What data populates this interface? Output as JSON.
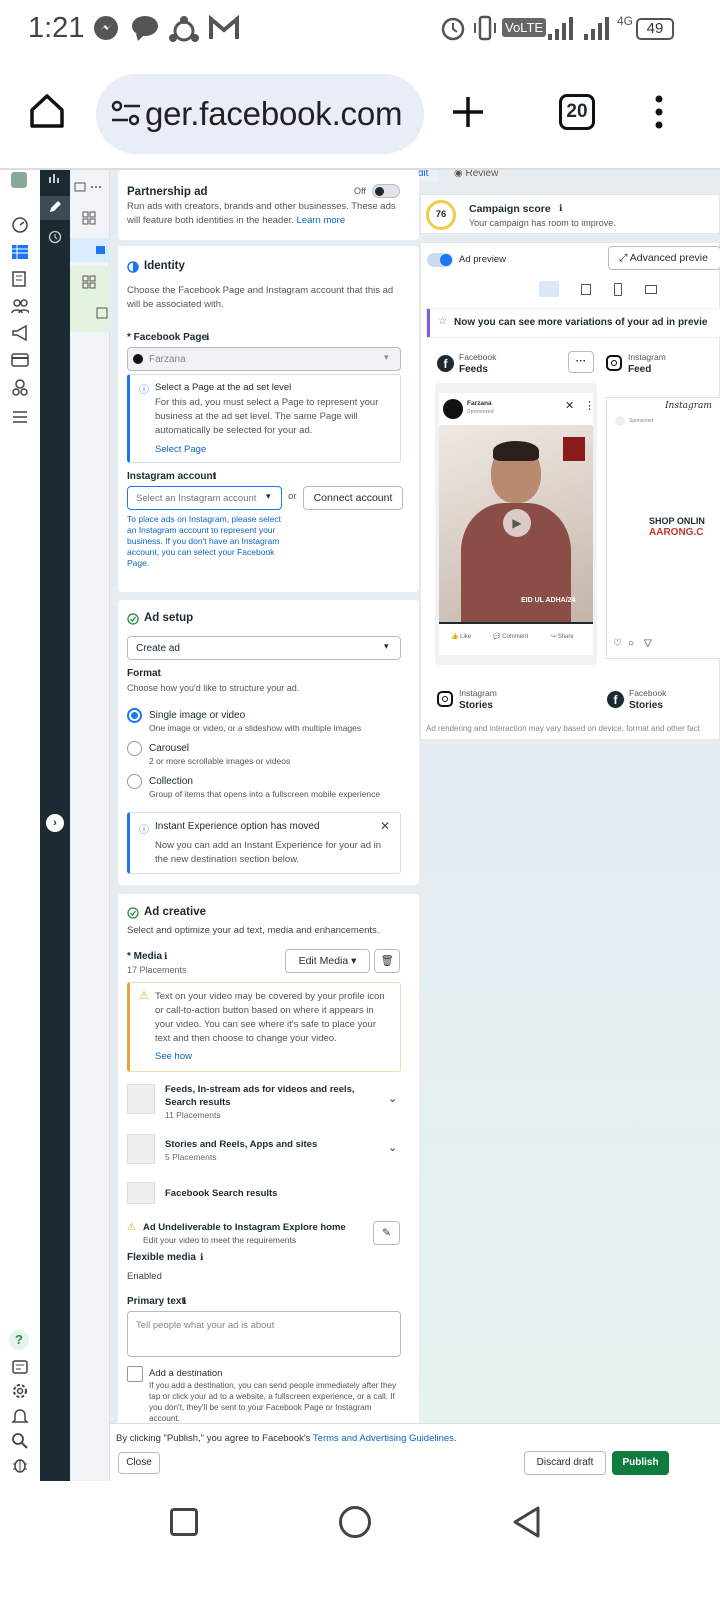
{
  "status_bar": {
    "time": "1:21",
    "volte": "VoLTE",
    "network": "4G",
    "battery": "49"
  },
  "browser": {
    "url": "ger.facebook.com",
    "tab_count": "20"
  },
  "header_tabs": {
    "edit": "Edit",
    "review": "Review"
  },
  "partnership": {
    "title": "Partnership ad",
    "toggle_label": "Off",
    "desc1": "Run ads with creators, brands and other businesses. These ads",
    "desc2": "will feature both identities in the header.",
    "learn_more": "Learn more"
  },
  "identity": {
    "title": "Identity",
    "desc1": "Choose the Facebook Page and Instagram account that this ad",
    "desc2": "will be associated with.",
    "fb_page_label": "* Facebook Page",
    "fb_page_value": "Farzana",
    "info_title": "Select a Page at the ad set level",
    "info_l1": "For this ad, you must select a Page to represent your",
    "info_l2": "business at the ad set level. The same Page will",
    "info_l3": "automatically be selected for your ad.",
    "select_page": "Select Page",
    "ig_label": "Instagram account",
    "ig_placeholder": "Select an Instagram account",
    "or": "or",
    "connect": "Connect account",
    "ig_help1": "To place ads on Instagram, please select",
    "ig_help2": "an Instagram account to represent your",
    "ig_help3": "business. If you don't have an Instagram",
    "ig_help4": "account, you can select your Facebook",
    "ig_help5": "Page."
  },
  "ad_setup": {
    "title": "Ad setup",
    "create_value": "Create ad",
    "format_label": "Format",
    "format_desc": "Choose how you'd like to structure your ad.",
    "options": [
      {
        "label": "Single image or video",
        "desc": "One image or video, or a slideshow with multiple images"
      },
      {
        "label": "Carousel",
        "desc": "2 or more scrollable images or videos"
      },
      {
        "label": "Collection",
        "desc": "Group of items that opens into a fullscreen mobile experience"
      }
    ],
    "notice_title": "Instant Experience option has moved",
    "notice_l1": "Now you can add an Instant Experience for your ad in",
    "notice_l2": "the new destination section below."
  },
  "ad_creative": {
    "title": "Ad creative",
    "desc": "Select and optimize your ad text, media and enhancements.",
    "media_label": "* Media",
    "placements": "17 Placements",
    "edit_media": "Edit Media",
    "warn_l1": "Text on your video may be covered by your profile icon",
    "warn_l2": "or call-to-action button based on where it appears in",
    "warn_l3": "your video. You can see where it's safe to place your",
    "warn_l4": "text and then choose to change your video.",
    "see_how": "See how",
    "groups": [
      {
        "title1": "Feeds, In-stream ads for videos and reels,",
        "title2": "Search results",
        "count": "11 Placements"
      },
      {
        "title1": "Stories and Reels, Apps and sites",
        "title2": "",
        "count": "5 Placements"
      },
      {
        "title1": "Facebook Search results",
        "title2": "",
        "count": ""
      }
    ],
    "undeliverable": "Ad Undeliverable to Instagram Explore home",
    "undeliverable_sub": "Edit your video to meet the requirements",
    "flexible": "Flexible media",
    "enabled": "Enabled",
    "primary_text": "Primary text",
    "primary_placeholder": "Tell people what your ad is about",
    "dest_title": "Add a destination",
    "dest_l1": "If you add a destination, you can send people immediately after they",
    "dest_l2": "tap or click your ad to a website, a fullscreen experience, or a call. If",
    "dest_l3": "you don't, they'll be sent to your Facebook Page or Instagram",
    "dest_l4": "account."
  },
  "campaign": {
    "score": "76",
    "title": "Campaign score",
    "desc": "Your campaign has room to improve."
  },
  "preview": {
    "toggle": "Ad preview",
    "advanced": "Advanced previe",
    "banner": "Now you can see more variations of your ad in previe",
    "fb_feeds_top": "Facebook",
    "fb_feeds": "Feeds",
    "ig_feed_top": "Instagram",
    "ig_feed": "Feed",
    "page_name": "Farzana",
    "sponsored": "Sponsored",
    "video_text": "EID UL ADHA/24",
    "like": "Like",
    "comment": "Comment",
    "share": "Share",
    "ig_logo": "Instagram",
    "shop1": "SHOP ONLIN",
    "shop2": "AARONG.C",
    "ig_stories_top": "Instagram",
    "ig_stories": "Stories",
    "fb_stories_top": "Facebook",
    "fb_stories": "Stories",
    "footer": "Ad rendering and interaction may vary based on device, format and other fact"
  },
  "bottom": {
    "agree_prefix": "By clicking \"Publish,\" you agree to Facebook's ",
    "agree_link": "Terms and Advertising Guidelines",
    "agree_suffix": ".",
    "close": "Close",
    "discard": "Discard draft",
    "publish": "Publish"
  },
  "colors": {
    "accent": "#1877f2",
    "publish": "#0f7b3e",
    "rail": "#1c2b33",
    "warning": "#e8a33d"
  }
}
